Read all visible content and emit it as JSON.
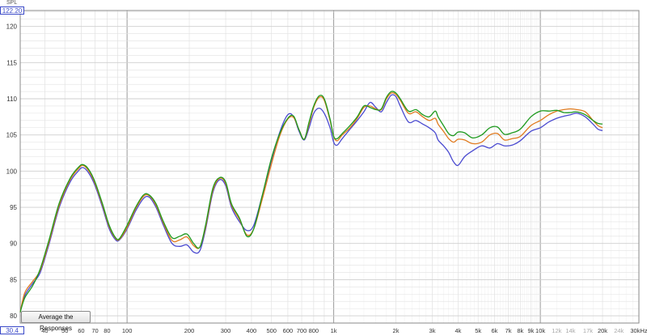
{
  "axis": {
    "unit": "SPL",
    "top_value": "122.20",
    "bottom_value": "30.4",
    "y_ticks": [
      "120",
      "115",
      "110",
      "105",
      "100",
      "95",
      "90",
      "85",
      "80"
    ],
    "x_ticks": [
      {
        "f": 40,
        "label": "40"
      },
      {
        "f": 50,
        "label": "50"
      },
      {
        "f": 60,
        "label": "60"
      },
      {
        "f": 70,
        "label": "70"
      },
      {
        "f": 80,
        "label": "80"
      },
      {
        "f": 100,
        "label": "100"
      },
      {
        "f": 200,
        "label": "200"
      },
      {
        "f": 300,
        "label": "300"
      },
      {
        "f": 400,
        "label": "400"
      },
      {
        "f": 500,
        "label": "500"
      },
      {
        "f": 600,
        "label": "600"
      },
      {
        "f": 700,
        "label": "700"
      },
      {
        "f": 800,
        "label": "800"
      },
      {
        "f": 1000,
        "label": "1k"
      },
      {
        "f": 2000,
        "label": "2k"
      },
      {
        "f": 3000,
        "label": "3k"
      },
      {
        "f": 4000,
        "label": "4k"
      },
      {
        "f": 5000,
        "label": "5k"
      },
      {
        "f": 6000,
        "label": "6k"
      },
      {
        "f": 7000,
        "label": "7k"
      },
      {
        "f": 8000,
        "label": "8k"
      },
      {
        "f": 9000,
        "label": "9k"
      },
      {
        "f": 10000,
        "label": "10k"
      },
      {
        "f": 12000,
        "label": "12k"
      },
      {
        "f": 14000,
        "label": "14k"
      },
      {
        "f": 17000,
        "label": "17k"
      },
      {
        "f": 20000,
        "label": "20k"
      },
      {
        "f": 24000,
        "label": "24k"
      },
      {
        "f": 30000,
        "label": "30kHz"
      }
    ]
  },
  "button": {
    "label": "Average the Responses"
  },
  "colors": {
    "background": "#ffffff",
    "grid_minor": "#e2e2e2",
    "grid_major": "#9a9a9a",
    "axis_text": "#333333",
    "blue": "#4a4ad0",
    "orange": "#e07a1e",
    "green": "#1e9a1e"
  },
  "chart_data": {
    "type": "line",
    "x_scale": "log",
    "xlim": [
      30.4,
      30000
    ],
    "ylim": [
      79,
      122.2
    ],
    "series": [
      {
        "color": "blue",
        "points": [
          [
            30.4,
            80.5
          ],
          [
            32,
            82.8
          ],
          [
            35,
            84.5
          ],
          [
            38,
            86
          ],
          [
            42,
            90
          ],
          [
            47,
            95
          ],
          [
            53,
            98.5
          ],
          [
            58,
            100
          ],
          [
            61,
            100.5
          ],
          [
            65,
            99.8
          ],
          [
            70,
            98
          ],
          [
            76,
            95
          ],
          [
            82,
            92
          ],
          [
            88,
            90.5
          ],
          [
            92,
            90.5
          ],
          [
            100,
            92
          ],
          [
            110,
            94.5
          ],
          [
            120,
            96.2
          ],
          [
            128,
            96.4
          ],
          [
            138,
            95
          ],
          [
            150,
            92.5
          ],
          [
            165,
            90
          ],
          [
            180,
            89.6
          ],
          [
            195,
            89.8
          ],
          [
            210,
            88.8
          ],
          [
            225,
            89
          ],
          [
            240,
            92
          ],
          [
            260,
            97
          ],
          [
            280,
            98.8
          ],
          [
            300,
            98
          ],
          [
            320,
            95
          ],
          [
            350,
            93
          ],
          [
            380,
            91.8
          ],
          [
            410,
            92.5
          ],
          [
            450,
            96.5
          ],
          [
            500,
            101.5
          ],
          [
            550,
            105.5
          ],
          [
            600,
            107.8
          ],
          [
            640,
            107.5
          ],
          [
            680,
            105.5
          ],
          [
            720,
            104.3
          ],
          [
            760,
            106
          ],
          [
            800,
            108
          ],
          [
            850,
            108.7
          ],
          [
            900,
            108
          ],
          [
            960,
            106
          ],
          [
            1000,
            104
          ],
          [
            1040,
            103.6
          ],
          [
            1100,
            104.5
          ],
          [
            1200,
            105.8
          ],
          [
            1300,
            107
          ],
          [
            1400,
            108.2
          ],
          [
            1500,
            109.5
          ],
          [
            1600,
            108.8
          ],
          [
            1700,
            108.2
          ],
          [
            1800,
            109.5
          ],
          [
            1900,
            110.5
          ],
          [
            2000,
            110.3
          ],
          [
            2100,
            109
          ],
          [
            2300,
            106.8
          ],
          [
            2500,
            107
          ],
          [
            2700,
            106.5
          ],
          [
            2900,
            106
          ],
          [
            3100,
            105.3
          ],
          [
            3200,
            104.3
          ],
          [
            3400,
            103.5
          ],
          [
            3600,
            102.6
          ],
          [
            3800,
            101.3
          ],
          [
            4000,
            100.8
          ],
          [
            4300,
            102
          ],
          [
            4700,
            102.8
          ],
          [
            5200,
            103.5
          ],
          [
            5700,
            103.2
          ],
          [
            6200,
            103.8
          ],
          [
            6700,
            103.5
          ],
          [
            7300,
            103.6
          ],
          [
            8000,
            104.2
          ],
          [
            9000,
            105.5
          ],
          [
            10000,
            106
          ],
          [
            11000,
            106.8
          ],
          [
            12000,
            107.3
          ],
          [
            13000,
            107.6
          ],
          [
            14000,
            107.8
          ],
          [
            15000,
            108
          ],
          [
            16500,
            107.5
          ],
          [
            18000,
            106.5
          ],
          [
            19000,
            105.8
          ],
          [
            20000,
            105.6
          ]
        ]
      },
      {
        "color": "orange",
        "points": [
          [
            30.4,
            80.5
          ],
          [
            32,
            83.2
          ],
          [
            35,
            84.8
          ],
          [
            38,
            86.3
          ],
          [
            42,
            90.3
          ],
          [
            47,
            95.3
          ],
          [
            53,
            98.8
          ],
          [
            58,
            100.3
          ],
          [
            61,
            100.8
          ],
          [
            65,
            100.1
          ],
          [
            70,
            98.3
          ],
          [
            76,
            95.3
          ],
          [
            82,
            92.3
          ],
          [
            88,
            90.7
          ],
          [
            92,
            90.6
          ],
          [
            100,
            92.2
          ],
          [
            110,
            94.8
          ],
          [
            120,
            96.5
          ],
          [
            128,
            96.6
          ],
          [
            138,
            95.3
          ],
          [
            150,
            92.8
          ],
          [
            165,
            90.4
          ],
          [
            180,
            90.5
          ],
          [
            195,
            90.9
          ],
          [
            210,
            89.7
          ],
          [
            225,
            89.5
          ],
          [
            240,
            92.3
          ],
          [
            260,
            97.3
          ],
          [
            280,
            99
          ],
          [
            300,
            98.3
          ],
          [
            320,
            95.3
          ],
          [
            350,
            93.3
          ],
          [
            380,
            91.2
          ],
          [
            410,
            92
          ],
          [
            450,
            96
          ],
          [
            500,
            101
          ],
          [
            550,
            105
          ],
          [
            600,
            107.2
          ],
          [
            640,
            107.4
          ],
          [
            680,
            105.7
          ],
          [
            720,
            104.4
          ],
          [
            760,
            106.5
          ],
          [
            800,
            108.8
          ],
          [
            850,
            110.2
          ],
          [
            900,
            109.8
          ],
          [
            960,
            107
          ],
          [
            1000,
            104.8
          ],
          [
            1040,
            104.2
          ],
          [
            1100,
            105
          ],
          [
            1200,
            106
          ],
          [
            1300,
            107.3
          ],
          [
            1400,
            108.8
          ],
          [
            1500,
            109
          ],
          [
            1600,
            108.6
          ],
          [
            1700,
            108.5
          ],
          [
            1800,
            110
          ],
          [
            1900,
            110.8
          ],
          [
            2000,
            110.6
          ],
          [
            2100,
            109.8
          ],
          [
            2300,
            108
          ],
          [
            2500,
            108.2
          ],
          [
            2700,
            107.5
          ],
          [
            2900,
            107
          ],
          [
            3100,
            107.3
          ],
          [
            3200,
            106.5
          ],
          [
            3400,
            105.5
          ],
          [
            3600,
            104.5
          ],
          [
            3800,
            104
          ],
          [
            4000,
            104.4
          ],
          [
            4300,
            104.3
          ],
          [
            4700,
            103.8
          ],
          [
            5200,
            104
          ],
          [
            5700,
            105
          ],
          [
            6200,
            105.2
          ],
          [
            6700,
            104.3
          ],
          [
            7300,
            104.5
          ],
          [
            8000,
            104.8
          ],
          [
            9000,
            106.3
          ],
          [
            10000,
            107
          ],
          [
            11000,
            107.8
          ],
          [
            12000,
            108.3
          ],
          [
            13000,
            108.5
          ],
          [
            14000,
            108.6
          ],
          [
            15000,
            108.5
          ],
          [
            16500,
            108.2
          ],
          [
            18000,
            107
          ],
          [
            19000,
            106.3
          ],
          [
            20000,
            106
          ]
        ]
      },
      {
        "color": "green",
        "points": [
          [
            30.4,
            80.5
          ],
          [
            32,
            82.5
          ],
          [
            35,
            84.2
          ],
          [
            38,
            86.5
          ],
          [
            42,
            90.6
          ],
          [
            47,
            95.6
          ],
          [
            53,
            99
          ],
          [
            58,
            100.5
          ],
          [
            61,
            100.9
          ],
          [
            65,
            100.3
          ],
          [
            70,
            98.5
          ],
          [
            76,
            95.5
          ],
          [
            82,
            92.5
          ],
          [
            88,
            90.8
          ],
          [
            92,
            90.7
          ],
          [
            100,
            92.5
          ],
          [
            110,
            95
          ],
          [
            120,
            96.7
          ],
          [
            128,
            96.7
          ],
          [
            138,
            95.5
          ],
          [
            150,
            93
          ],
          [
            165,
            90.8
          ],
          [
            180,
            91
          ],
          [
            195,
            91.3
          ],
          [
            210,
            90
          ],
          [
            225,
            89.5
          ],
          [
            240,
            92.6
          ],
          [
            260,
            97.6
          ],
          [
            280,
            99.1
          ],
          [
            300,
            98.5
          ],
          [
            320,
            95.5
          ],
          [
            350,
            93.5
          ],
          [
            380,
            91
          ],
          [
            410,
            92
          ],
          [
            450,
            96.5
          ],
          [
            500,
            101.8
          ],
          [
            550,
            105.3
          ],
          [
            600,
            107.3
          ],
          [
            640,
            107.6
          ],
          [
            680,
            105.7
          ],
          [
            720,
            104.4
          ],
          [
            760,
            106.8
          ],
          [
            800,
            109
          ],
          [
            850,
            110.4
          ],
          [
            900,
            110
          ],
          [
            960,
            107.2
          ],
          [
            1000,
            104.8
          ],
          [
            1040,
            104.5
          ],
          [
            1100,
            105.2
          ],
          [
            1200,
            106.3
          ],
          [
            1300,
            107.5
          ],
          [
            1400,
            109
          ],
          [
            1500,
            108.8
          ],
          [
            1600,
            108.5
          ],
          [
            1700,
            108.6
          ],
          [
            1800,
            110.2
          ],
          [
            1900,
            111
          ],
          [
            2000,
            110.8
          ],
          [
            2100,
            110
          ],
          [
            2300,
            108.3
          ],
          [
            2500,
            108.5
          ],
          [
            2700,
            107.8
          ],
          [
            2900,
            107.5
          ],
          [
            3100,
            108.3
          ],
          [
            3200,
            107.5
          ],
          [
            3400,
            106.3
          ],
          [
            3600,
            105.2
          ],
          [
            3800,
            104.9
          ],
          [
            4000,
            105.4
          ],
          [
            4300,
            105.3
          ],
          [
            4700,
            104.6
          ],
          [
            5200,
            105
          ],
          [
            5700,
            106
          ],
          [
            6200,
            106.1
          ],
          [
            6700,
            105.1
          ],
          [
            7300,
            105.3
          ],
          [
            8000,
            105.8
          ],
          [
            9000,
            107.5
          ],
          [
            10000,
            108.3
          ],
          [
            11000,
            108.3
          ],
          [
            12000,
            108.4
          ],
          [
            13000,
            108.1
          ],
          [
            14000,
            108.1
          ],
          [
            15000,
            108.2
          ],
          [
            16500,
            107.8
          ],
          [
            18000,
            107
          ],
          [
            19000,
            106.6
          ],
          [
            20000,
            106.5
          ]
        ]
      }
    ]
  }
}
